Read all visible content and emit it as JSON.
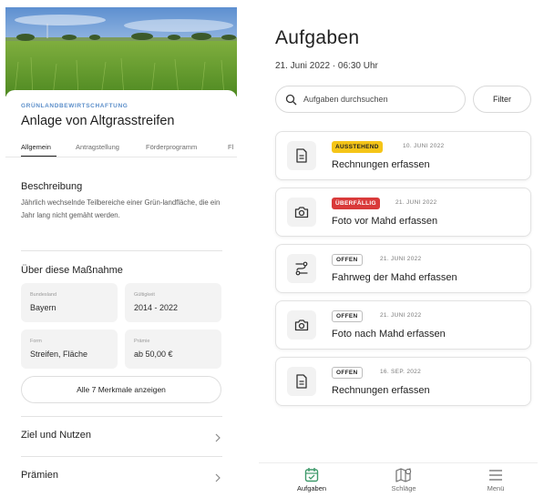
{
  "measure": {
    "category": "GRÜNLANDBEWIRTSCHAFTUNG",
    "title": "Anlage von Altgrasstreifen",
    "tabs": [
      "Allgemein",
      "Antragstellung",
      "Förderprogramm",
      "Fl"
    ],
    "active_tab": "Allgemein",
    "description": {
      "heading": "Beschreibung",
      "text": "Jährlich wechselnde Teilbereiche einer Grün-landfläche, die ein Jahr lang nicht gemäht werden."
    },
    "about": {
      "heading": "Über diese Maßnahme",
      "attributes": [
        {
          "label": "Bundesland",
          "value": "Bayern"
        },
        {
          "label": "Gültigkeit",
          "value": "2014 - 2022"
        },
        {
          "label": "Form",
          "value": "Streifen, Fläche"
        },
        {
          "label": "Prämie",
          "value": "ab 50,00 €"
        }
      ],
      "all_button": "Alle 7 Merkmale anzeigen"
    },
    "rows": [
      "Ziel und Nutzen",
      "Prämien"
    ]
  },
  "tasks_page": {
    "title": "Aufgaben",
    "date": "21. Juni 2022 · 06:30 Uhr",
    "search": {
      "placeholder": "Aufgaben durchsuchen"
    },
    "filter_label": "Filter",
    "tasks": [
      {
        "status": "AUSSTEHEND",
        "status_type": "pending",
        "date": "10. JUNI 2022",
        "name": "Rechnungen erfassen",
        "icon": "document-icon"
      },
      {
        "status": "ÜBERFÄLLIG",
        "status_type": "overdue",
        "date": "21. JUNI 2022",
        "name": "Foto vor Mahd erfassen",
        "icon": "camera-icon"
      },
      {
        "status": "OFFEN",
        "status_type": "open",
        "date": "21. JUNI 2022",
        "name": "Fahrweg der Mahd erfassen",
        "icon": "route-icon"
      },
      {
        "status": "OFFEN",
        "status_type": "open",
        "date": "21. JUNI 2022",
        "name": "Foto nach Mahd erfassen",
        "icon": "camera-icon"
      },
      {
        "status": "OFFEN",
        "status_type": "open",
        "date": "16. SEP. 2022",
        "name": "Rechnungen erfassen",
        "icon": "document-icon"
      }
    ],
    "nav": [
      {
        "label": "Aufgaben",
        "icon": "calendar-icon",
        "active": true
      },
      {
        "label": "Schläge",
        "icon": "map-icon",
        "active": false
      },
      {
        "label": "Menü",
        "icon": "menu-icon",
        "active": false
      }
    ]
  },
  "colors": {
    "accent_green": "#3f9a6b",
    "category_blue": "#5b8ec9",
    "pending": "#f5c518",
    "overdue": "#d93a3a"
  }
}
